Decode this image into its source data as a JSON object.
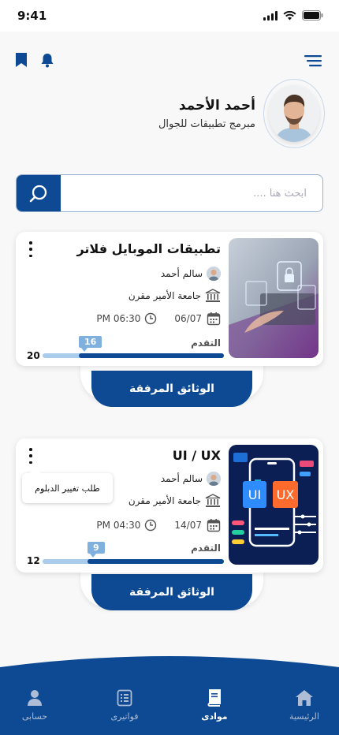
{
  "status": {
    "time": "9:41"
  },
  "profile": {
    "name": "أحمد الأحمد",
    "role": "مبرمج تطبيقات للجوال"
  },
  "search": {
    "placeholder": "ابحث هنا ...."
  },
  "courses": [
    {
      "title": "تطبيقات الموبايل فلاتر",
      "instructor": "سالم أحمد",
      "university": "جامعة الأمير مقرن",
      "date": "06/07",
      "time": "06:30 PM",
      "progress_label": "التقدم",
      "progress_current": "16",
      "progress_total": "20",
      "progress_value": 16,
      "progress_max": 20,
      "attachments_label": "الوثائق المرفقة"
    },
    {
      "title": "UI / UX",
      "instructor": "سالم أحمد",
      "university": "جامعة الأمير مقرن",
      "date": "14/07",
      "time": "04:30 PM",
      "progress_label": "التقدم",
      "progress_current": "9",
      "progress_total": "12",
      "progress_value": 9,
      "progress_max": 12,
      "attachments_label": "الوثائق المرفقة",
      "ui_tag": "UI",
      "ux_tag": "UX"
    }
  ],
  "tooltip": {
    "text": "طلب تغيير الدبلوم"
  },
  "nav": {
    "home": "الرئيسية",
    "materials": "موادى",
    "invoices": "فواتيرى",
    "account": "حسابى"
  },
  "colors": {
    "primary": "#0d4a93",
    "progress_track": "#a9ccec",
    "badge": "#7fb0de"
  }
}
